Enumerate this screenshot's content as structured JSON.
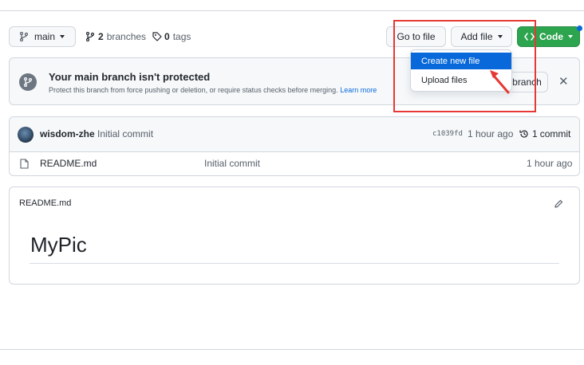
{
  "toolbar": {
    "branch_label": "main",
    "branches_count": "2",
    "branches_label": "branches",
    "tags_count": "0",
    "tags_label": "tags",
    "goto_file_label": "Go to file",
    "add_file_label": "Add file",
    "code_label": "Code"
  },
  "add_file_menu": {
    "items": [
      {
        "label": "Create new file"
      },
      {
        "label": "Upload files"
      }
    ]
  },
  "protection_banner": {
    "title": "Your main branch isn't protected",
    "description": "Protect this branch from force pushing or deletion, or require status checks before merging.",
    "learn_more": "Learn more",
    "button_label": "branch"
  },
  "latest_commit": {
    "author": "wisdom-zhe",
    "message": "Initial commit",
    "sha": "c1039fd",
    "time": "1 hour ago",
    "commits_count": "1",
    "commits_label": "commit"
  },
  "files": [
    {
      "name": "README.md",
      "message": "Initial commit",
      "time": "1 hour ago"
    }
  ],
  "readme": {
    "label": "README.md",
    "title": "MyPic"
  },
  "colors": {
    "accent": "#0969da",
    "primary_button": "#2da44e",
    "annotation": "#e53935"
  }
}
